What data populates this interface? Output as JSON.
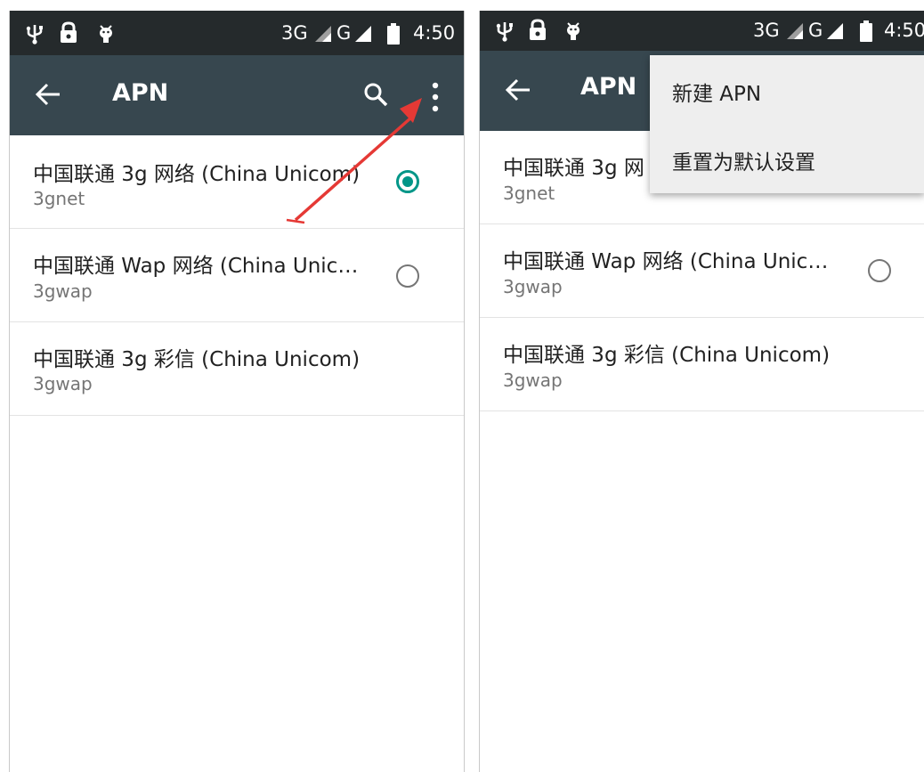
{
  "status_bar": {
    "network": "3G",
    "network2": "G",
    "time": "4:50",
    "icons": [
      "usb-icon",
      "lock-icon",
      "android-debug-icon",
      "signal-icon",
      "battery-icon"
    ]
  },
  "app_bar": {
    "title": "APN",
    "icons": [
      "back-arrow-icon",
      "search-icon",
      "overflow-menu-icon"
    ]
  },
  "apn_list": [
    {
      "name": "中国联通 3g 网络 (China Unicom)",
      "apn": "3gnet",
      "selected": true
    },
    {
      "name": "中国联通 Wap 网络 (China Unic…",
      "apn": "3gwap",
      "selected": false
    },
    {
      "name": "中国联通 3g 彩信 (China Unicom)",
      "apn": "3gwap",
      "selected": null
    }
  ],
  "right_panel": {
    "row1_title_visible": "中国联通 3g 网"
  },
  "overflow_menu": {
    "items": [
      "新建 APN",
      "重置为默认设置"
    ]
  },
  "colors": {
    "status_bar": "#252a2c",
    "app_bar": "#37474f",
    "accent": "#009688",
    "annotation_arrow": "#e53935",
    "menu_background": "#eeeeee"
  }
}
